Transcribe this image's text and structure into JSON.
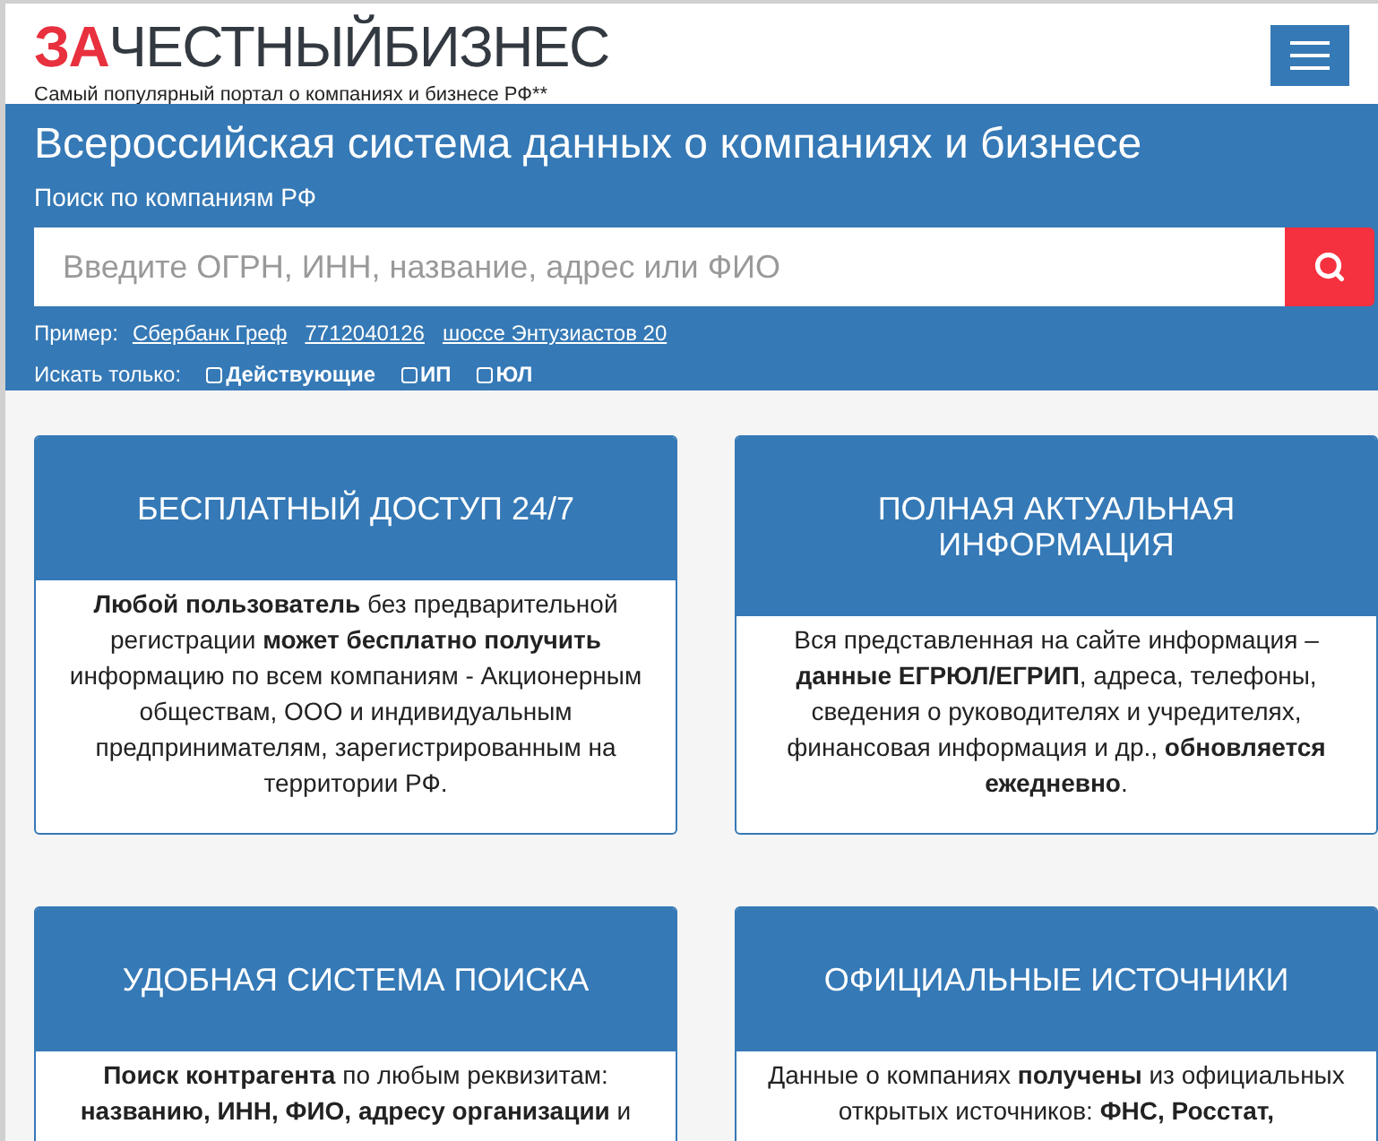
{
  "logo": {
    "accent": "ЗА",
    "rest": "ЧЕСТНЫЙБИЗНЕС",
    "tagline": "Самый популярный портал о компаниях и бизнесе РФ**"
  },
  "hero": {
    "title": "Всероссийская система данных о компаниях и бизнесе",
    "subtitle": "Поиск по компаниям РФ",
    "search": {
      "placeholder": "Введите ОГРН, ИНН, название, адрес или ФИО"
    },
    "examples_label": "Пример:",
    "examples": [
      "Сбербанк Греф",
      "7712040126",
      "шоссе Энтузиастов 20"
    ],
    "filters_label": "Искать только:",
    "filters": [
      {
        "label": "Действующие",
        "checked": false
      },
      {
        "label": "ИП",
        "checked": false
      },
      {
        "label": "ЮЛ",
        "checked": false
      }
    ]
  },
  "cards": [
    {
      "title": "БЕСПЛАТНЫЙ ДОСТУП 24/7",
      "text": "**Любой пользователь** без предварительной регистрации **может бесплатно получить** информацию по всем компаниям - Акционерным обществам, ООО и индивидуальным предпринимателям, зарегистрированным на территории РФ."
    },
    {
      "title": "ПОЛНАЯ АКТУАЛЬНАЯ ИНФОРМАЦИЯ",
      "text": "Вся представленная на сайте информация – **данные ЕГРЮЛ/ЕГРИП**, адреса, телефоны, сведения о руководителях и учредителях, финансовая информация и др., **обновляется ежедневно**."
    },
    {
      "title": "УДОБНАЯ СИСТЕМА ПОИСКА",
      "text": "**Поиск контрагента** по любым реквизитам: **названию, ИНН, ФИО, адресу организации** и"
    },
    {
      "title": "ОФИЦИАЛЬНЫЕ ИСТОЧНИКИ",
      "text": "Данные о компаниях **получены** из официальных открытых источников: **ФНС, Росстат,**"
    }
  ]
}
